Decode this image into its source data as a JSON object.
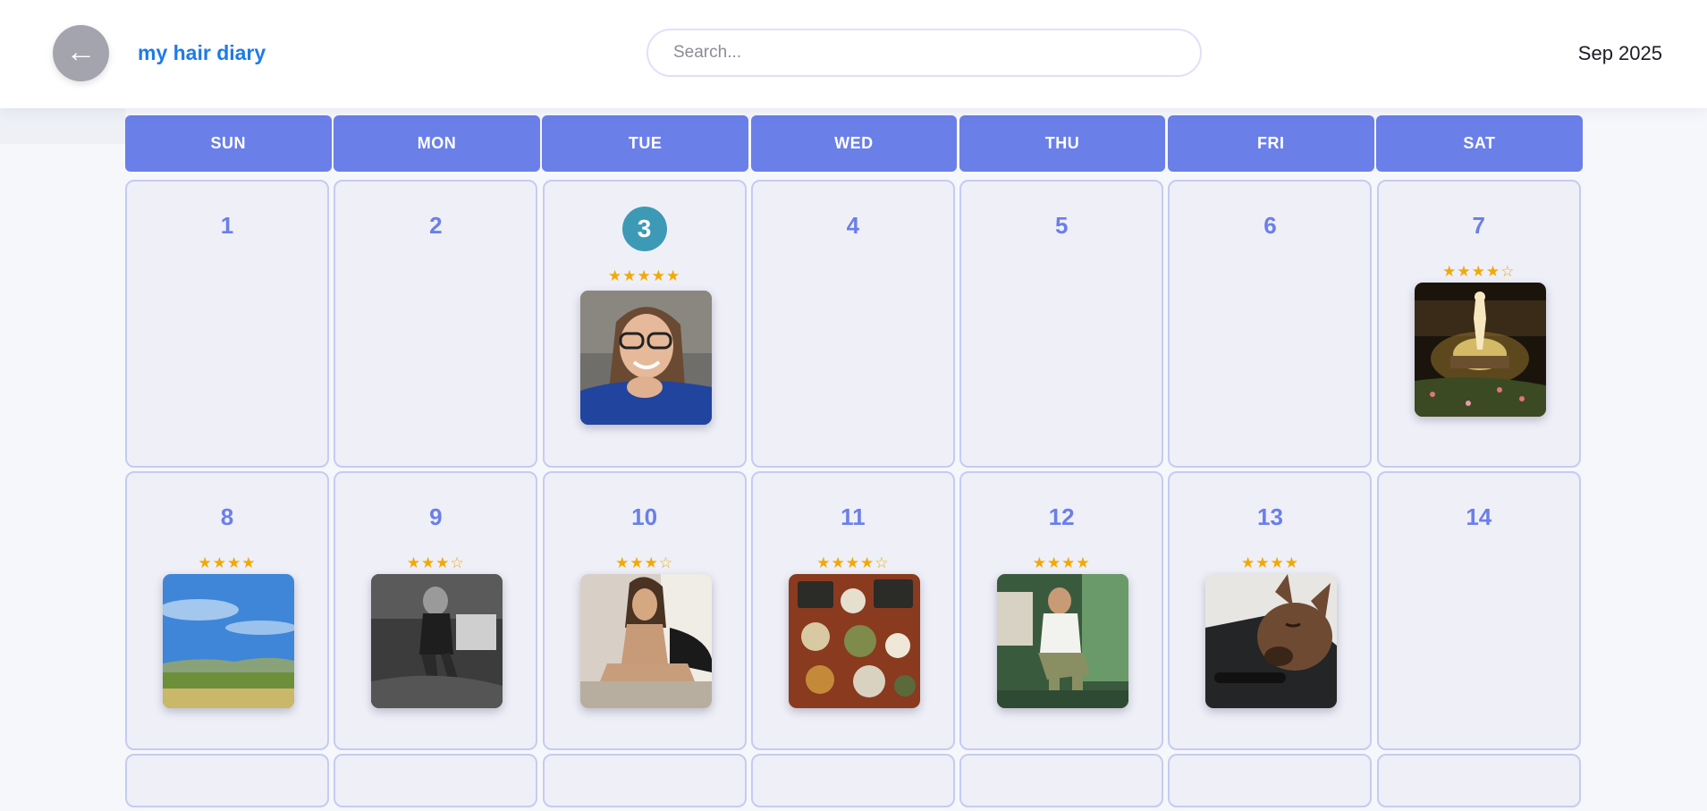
{
  "header": {
    "back_icon": "←",
    "title": "my hair diary",
    "search_placeholder": "Search...",
    "month_label": "Sep 2025"
  },
  "calendar": {
    "weekdays": [
      "SUN",
      "MON",
      "TUE",
      "WED",
      "THU",
      "FRI",
      "SAT"
    ],
    "today": 3,
    "weeks": [
      [
        {
          "day": "1"
        },
        {
          "day": "2"
        },
        {
          "day": "3",
          "today": true,
          "stars": "★★★★★",
          "photo": "woman-with-glasses-photo"
        },
        {
          "day": "4"
        },
        {
          "day": "5"
        },
        {
          "day": "6"
        },
        {
          "day": "7",
          "stars": "★★★★☆",
          "photo": "lit-statue-night-photo"
        }
      ],
      [
        {
          "day": "8",
          "stars": "★★★★",
          "photo": "landscape-sky-photo"
        },
        {
          "day": "9",
          "stars": "★★★☆",
          "photo": "skateboarder-bw-photo"
        },
        {
          "day": "10",
          "stars": "★★★☆",
          "photo": "woman-sitting-photo"
        },
        {
          "day": "11",
          "stars": "★★★★☆",
          "photo": "food-table-photo"
        },
        {
          "day": "12",
          "stars": "★★★★",
          "photo": "man-sitting-photo"
        },
        {
          "day": "13",
          "stars": "★★★★",
          "photo": "dog-sleeping-photo"
        },
        {
          "day": "14"
        }
      ]
    ]
  },
  "colors": {
    "accent": "#6a7fe8",
    "title": "#1e7be6",
    "today": "#3d9ab6",
    "stars": "#f2a900",
    "cell_bg": "#efeff8"
  }
}
